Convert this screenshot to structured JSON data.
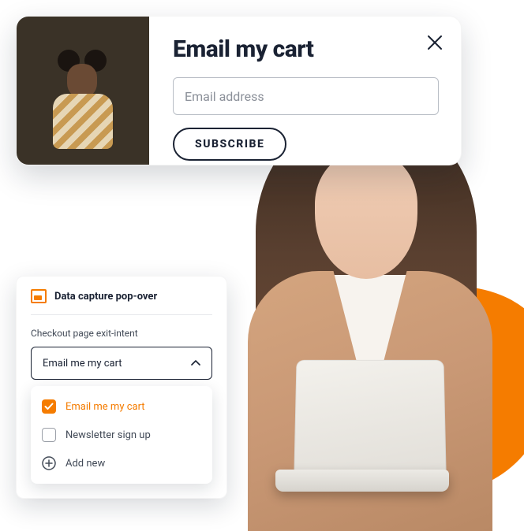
{
  "popup": {
    "title": "Email my cart",
    "email_placeholder": "Email address",
    "subscribe_label": "SUBSCRIBE"
  },
  "panel": {
    "title": "Data capture pop-over",
    "field_label": "Checkout page exit-intent",
    "selected": "Email me my cart",
    "options": {
      "email_cart": "Email me my cart",
      "newsletter": "Newsletter sign up",
      "add_new": "Add new"
    }
  },
  "colors": {
    "accent": "#f57c00",
    "text": "#1a2233"
  }
}
